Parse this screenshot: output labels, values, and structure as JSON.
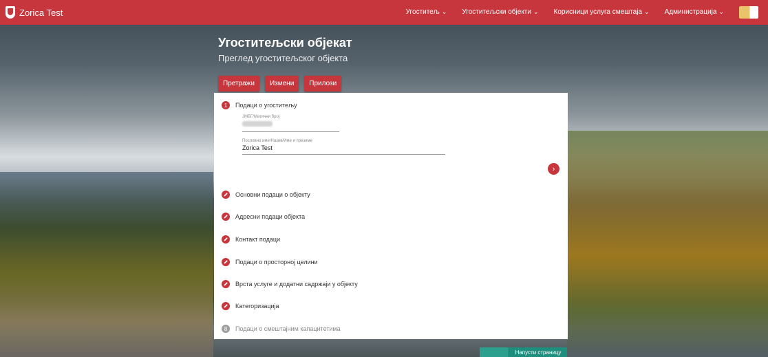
{
  "app": {
    "brand": "Zorica Test"
  },
  "nav": {
    "items": [
      "Угоститељ",
      "Угоститељски објекти",
      "Корисници услуга смештаја",
      "Администрација"
    ]
  },
  "header": {
    "title": "Угоститељски објекат",
    "subtitle": "Преглед угоститељског објекта"
  },
  "actions": {
    "search": "Претражи",
    "edit": "Измени",
    "attachments": "Прилози"
  },
  "sections": {
    "s1": {
      "number": "1",
      "label": "Подаци о угоститељу"
    },
    "s2": {
      "label": "Основни подаци о објекту"
    },
    "s3": {
      "label": "Адресни подаци објекта"
    },
    "s4": {
      "label": "Контакт подаци"
    },
    "s5": {
      "label": "Подаци о просторној целини"
    },
    "s6": {
      "label": "Врста услуге и додатни садржаји у објекту"
    },
    "s7": {
      "label": "Категоризација"
    },
    "s8": {
      "number": "8",
      "label": "Подаци о смештајним капацитетима"
    }
  },
  "fields": {
    "jmbg": {
      "label": "ЈМБГ/Матични број",
      "value": ""
    },
    "name": {
      "label": "Пословно име/Назив/Име и презиме",
      "value": "Zorica Test"
    }
  },
  "footer": {
    "leave_label": "Напусти страницу"
  },
  "colors": {
    "accent": "#c8363d",
    "footer_button": "#1e8e7e"
  },
  "icons": {
    "next": "chevron-right-icon",
    "edit": "pencil-icon",
    "crest": "crest-icon"
  }
}
